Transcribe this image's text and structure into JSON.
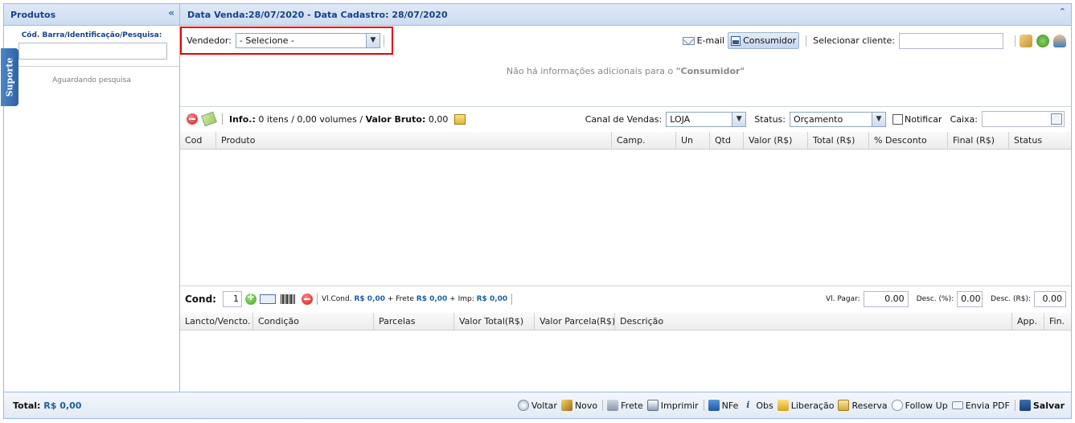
{
  "left_panel": {
    "title": "Produtos",
    "search_label": "Cód. Barra/Identificação/Pesquisa:",
    "search_value": "",
    "waiting_text": "Aguardando pesquisa",
    "support_tab": "Suporte"
  },
  "header": {
    "title": "Data Venda:28/07/2020 - Data Cadastro: 28/07/2020"
  },
  "seller": {
    "label": "Vendedor:",
    "selected": "- Selecione -"
  },
  "client": {
    "email_label": "E-mail",
    "consumidor_label": "Consumidor",
    "select_label": "Selecionar cliente:",
    "input_value": ""
  },
  "info_message": {
    "prefix": "Não há informações adicionais para o ",
    "name": "\"Consumidor\""
  },
  "items_toolbar": {
    "info_label": "Info.:",
    "info_text": "0 itens / 0,00 volumes /",
    "bruto_label": "Valor Bruto:",
    "bruto_value": "0,00",
    "channel_label": "Canal de Vendas:",
    "channel_value": "LOJA",
    "status_label": "Status:",
    "status_value": "Orçamento",
    "notify_label": "Notificar",
    "caixa_label": "Caixa:",
    "caixa_value": ""
  },
  "items_grid": {
    "columns": [
      "Cod",
      "Produto",
      "Camp.",
      "Un",
      "Qtd",
      "Valor (R$)",
      "Total (R$)",
      "% Desconto",
      "Final (R$)",
      "Status"
    ]
  },
  "conditions_toolbar": {
    "label": "Cond:",
    "qty_value": "1",
    "vlcond_label": "Vl.Cond.",
    "vlcond_value": "R$ 0,00",
    "frete_label": "+ Frete",
    "frete_value": "R$ 0,00",
    "imp_label": "+ Imp:",
    "imp_value": "R$ 0,00",
    "pagar_label": "Vl. Pagar:",
    "pagar_value": "0.00",
    "desc_pct_label": "Desc. (%):",
    "desc_pct_value": "0.00",
    "desc_rs_label": "Desc. (R$):",
    "desc_rs_value": "0.00"
  },
  "conditions_grid": {
    "columns": [
      "Lancto/Vencto.",
      "Condição",
      "Parcelas",
      "Valor Total(R$)",
      "Valor Parcela(R$)",
      "Descrição",
      "App.",
      "Fin."
    ]
  },
  "footer": {
    "total_label": "Total:",
    "total_value": "R$ 0,00",
    "actions": [
      "Voltar",
      "Novo",
      "Frete",
      "Imprimir",
      "NFe",
      "Obs",
      "Liberação",
      "Reserva",
      "Follow Up",
      "Envia PDF",
      "Salvar"
    ]
  },
  "colors": {
    "header_text": "#15428b",
    "border": "#99bbe8",
    "highlight_box": "#ee0000",
    "value_blue": "#1a5fa8"
  }
}
